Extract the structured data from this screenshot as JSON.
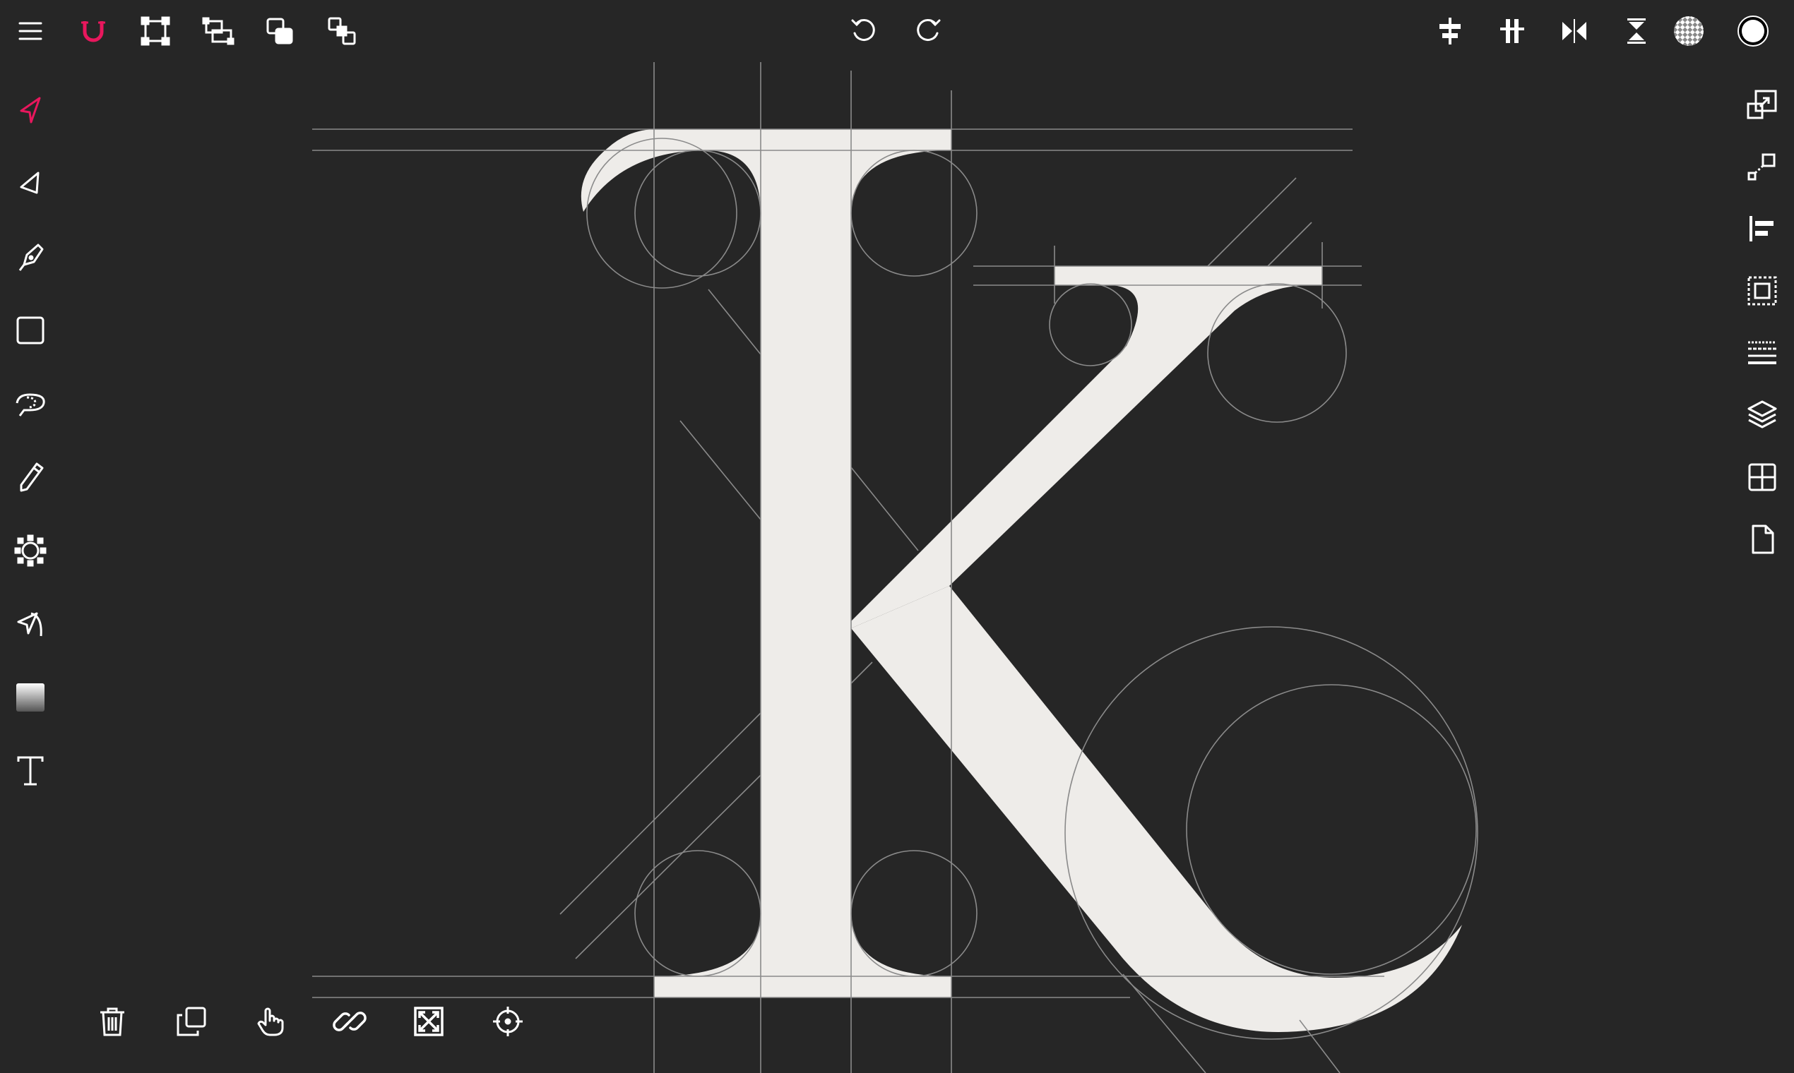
{
  "colors": {
    "background": "#262626",
    "glyph": "#eeece9",
    "guide": "#8a8a8a",
    "icon": "#ffffff",
    "accent": "#e8175d"
  },
  "top_toolbar": {
    "left_icons": [
      "menu-icon",
      "magnet-snap-icon",
      "transform-icon",
      "resize-icon",
      "bring-forward-icon",
      "arrange-icon"
    ],
    "center_icons": [
      "undo-icon",
      "redo-icon"
    ],
    "right_icons": [
      "align-horizontal-center-icon",
      "align-distribute-icon",
      "flip-horizontal-icon",
      "flip-vertical-icon",
      "pattern-fill-swatch",
      "color-swatch"
    ]
  },
  "left_toolbar": {
    "tools": [
      "select-tool-icon",
      "direct-select-tool-icon",
      "pen-tool-icon",
      "rectangle-tool-icon",
      "lasso-tool-icon",
      "pencil-tool-icon",
      "gear-shape-tool-icon",
      "curve-tool-icon",
      "gradient-tool-icon",
      "text-tool-icon"
    ]
  },
  "right_toolbar": {
    "panels": [
      "scale-panel-icon",
      "position-panel-icon",
      "align-panel-icon",
      "bounding-box-panel-icon",
      "hatch-lines-panel-icon",
      "layers-panel-icon",
      "grid-panel-icon",
      "document-panel-icon"
    ]
  },
  "bottom_toolbar": {
    "actions": [
      "trash-icon",
      "duplicate-icon",
      "hand-pan-icon",
      "link-icon",
      "fit-to-screen-icon",
      "crosshair-center-icon"
    ]
  }
}
